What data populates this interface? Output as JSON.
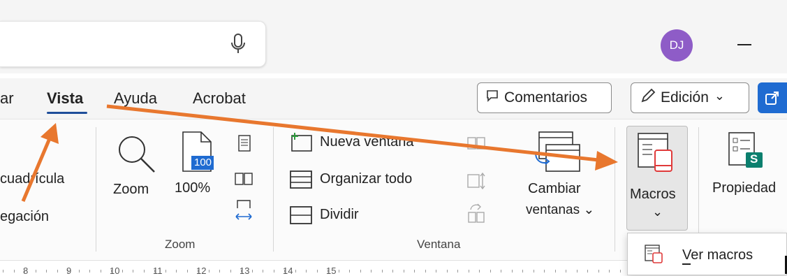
{
  "tabs": [
    {
      "label": "ar",
      "active": false
    },
    {
      "label": "Vista",
      "active": true
    },
    {
      "label": "Ayuda",
      "active": false
    },
    {
      "label": "Acrobat",
      "active": false
    }
  ],
  "header": {
    "avatar_initials": "DJ",
    "comments_label": "Comentarios",
    "edit_label": "Edición",
    "edit_chevron": "⌄"
  },
  "ribbon": {
    "show": {
      "gridlines_label": "cuadrícula",
      "navigation_label": "egación"
    },
    "zoom_group": {
      "zoom_label": "Zoom",
      "hundred_label": "100%",
      "hundred_icon_text": "100",
      "group_label": "Zoom"
    },
    "window_group": {
      "new_window_label": "Nueva ventana",
      "arrange_all_label": "Organizar todo",
      "split_label": "Dividir",
      "switch_windows_line1": "Cambiar",
      "switch_windows_line2": "ventanas ⌄",
      "group_label": "Ventana"
    },
    "macros": {
      "label": "Macros",
      "chevron": "⌄"
    },
    "properties_label": "Propiedad",
    "properties_icon_letter": "S"
  },
  "dropdown": {
    "view_macros_label": "Ver macros"
  },
  "ruler": {
    "numbers": [
      "8",
      "9",
      "10",
      "11",
      "12",
      "13",
      "14",
      "15"
    ]
  },
  "colors": {
    "arrow": "#e8772e",
    "accent": "#1f4e9a",
    "avatar": "#8e5cc7",
    "macro_red": "#e03a3a",
    "sharepoint_green": "#0b7f6e"
  }
}
